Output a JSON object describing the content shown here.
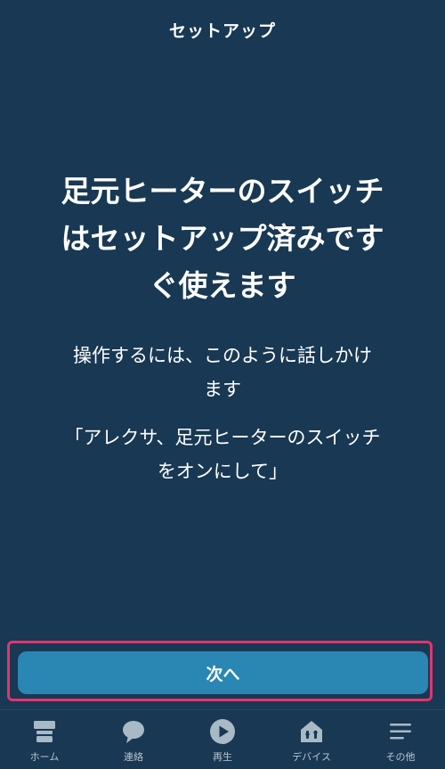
{
  "header": {
    "title": "セットアップ"
  },
  "main": {
    "headline_line1": "足元ヒーターのスイッチ",
    "headline_line2": "はセットアップ済みです",
    "headline_line3": "ぐ使えます",
    "instruction_line1": "操作するには、このように話しかけ",
    "instruction_line2": "ます",
    "quote_line1": "「アレクサ、足元ヒーターのスイッチ",
    "quote_line2": "をオンにして」"
  },
  "next_button": {
    "label": "次へ",
    "highlight_color": "#e2346f",
    "bg_color": "#2a86b3"
  },
  "bottom_nav": {
    "items": [
      {
        "label": "ホーム",
        "icon": "home-icon"
      },
      {
        "label": "連絡",
        "icon": "chat-icon"
      },
      {
        "label": "再生",
        "icon": "play-icon"
      },
      {
        "label": "デバイス",
        "icon": "devices-icon"
      },
      {
        "label": "その他",
        "icon": "menu-icon"
      }
    ]
  },
  "colors": {
    "background": "#183853",
    "text": "#ffffff",
    "nav_icon": "#a9bac6"
  }
}
